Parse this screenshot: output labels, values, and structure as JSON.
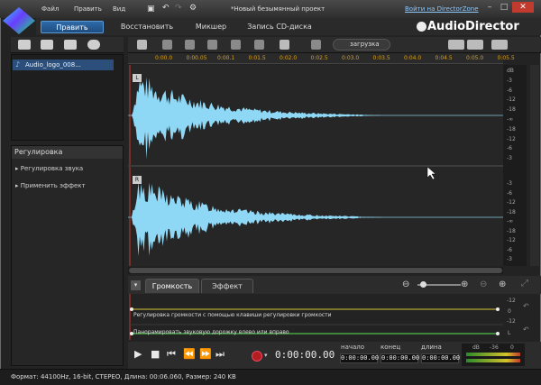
{
  "window": {
    "menu": [
      "Файл",
      "Править",
      "Вид"
    ],
    "title": "*Новый безымянный проект",
    "link": "Войти на DirectorZone",
    "minimize": "–",
    "maximize": "□",
    "close": "✕"
  },
  "nav": {
    "tabs": [
      "Править",
      "Восстановить",
      "Микшер",
      "Запись CD-диска"
    ],
    "brand": "AudioDirector"
  },
  "library": {
    "items": [
      "Audio_logo_008..."
    ]
  },
  "adjust": {
    "title": "Регулировка",
    "items": [
      "Регулировка звука",
      "Применить эффект"
    ]
  },
  "toolbar": {
    "upload_label": "загрузка"
  },
  "ruler": {
    "labels": [
      "0:00.0",
      "0:00.05",
      "0:00.1",
      "0:01.5",
      "0:02.0",
      "0:02.5",
      "0:03.0",
      "0:03.5",
      "0:04.0",
      "0:04.5",
      "0:05.0",
      "0:05.5"
    ]
  },
  "db_scale": {
    "top": [
      "dB",
      "-3",
      "-6",
      "-12",
      "-18",
      "-∞",
      "-18",
      "-12",
      "-6",
      "-3"
    ],
    "bottom": [
      "-3",
      "-6",
      "-12",
      "-18",
      "-∞",
      "-18",
      "-12",
      "-6",
      "-3"
    ]
  },
  "channels": {
    "left": "L",
    "right": "R"
  },
  "tabs": {
    "volume": "Громкость",
    "effect": "Эффект"
  },
  "lanes": {
    "volume": "Регулировка громкости с помощью клавиши регулировки громкости",
    "pan": "Панорамировать звуковую дорожку влево или вправо",
    "db_marks": [
      "-12",
      "0",
      "-12",
      "L"
    ]
  },
  "transport": {
    "time": "0:00:00.00",
    "start_label": "начало",
    "end_label": "конец",
    "length_label": "длина",
    "start": "0:00:00.00",
    "end": "0:00:00.00",
    "length": "0:00:00.00",
    "meter_labels": [
      "dB",
      "-36",
      "0"
    ]
  },
  "status": {
    "text": "Формат: 44100Hz, 16-bit, СТЕРЕО, Длина: 00:06.060, Размер: 240 KB"
  }
}
